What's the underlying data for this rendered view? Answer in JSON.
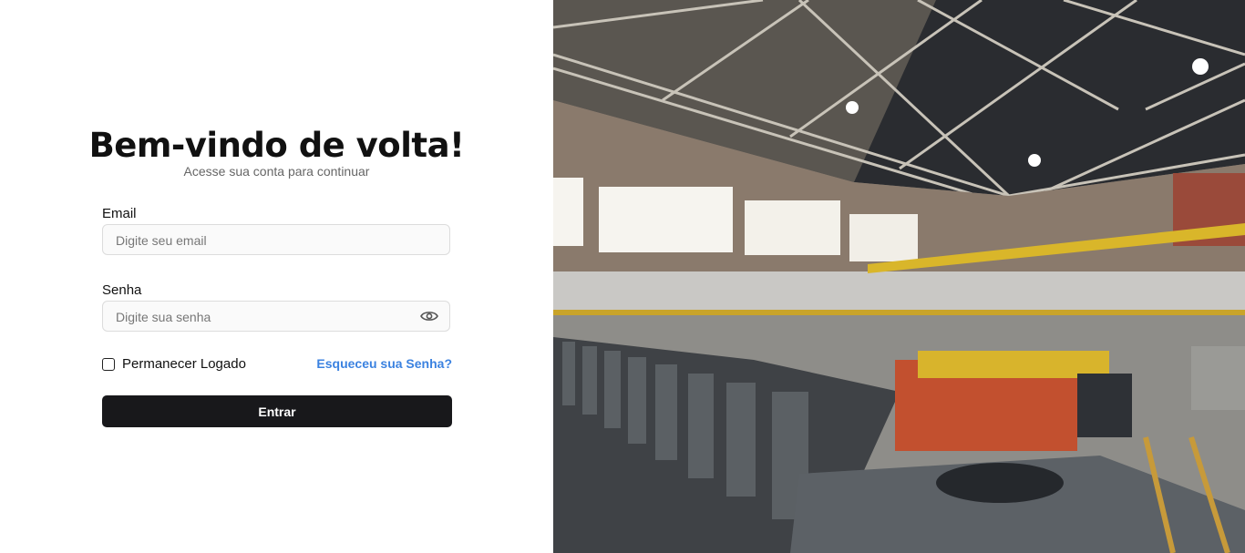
{
  "login": {
    "title": "Bem-vindo de volta!",
    "subtitle": "Acesse sua conta para continuar",
    "email_label": "Email",
    "email_placeholder": "Digite seu email",
    "email_value": "",
    "password_label": "Senha",
    "password_placeholder": "Digite sua senha",
    "password_value": "",
    "remember_label": "Permanecer Logado",
    "remember_checked": false,
    "forgot_label": "Esqueceu sua Senha?",
    "submit_label": "Entrar"
  },
  "colors": {
    "button_bg": "#18181b",
    "link": "#3b82e0",
    "input_border": "#dcdcdc"
  },
  "icons": {
    "password_toggle": "eye-icon"
  }
}
